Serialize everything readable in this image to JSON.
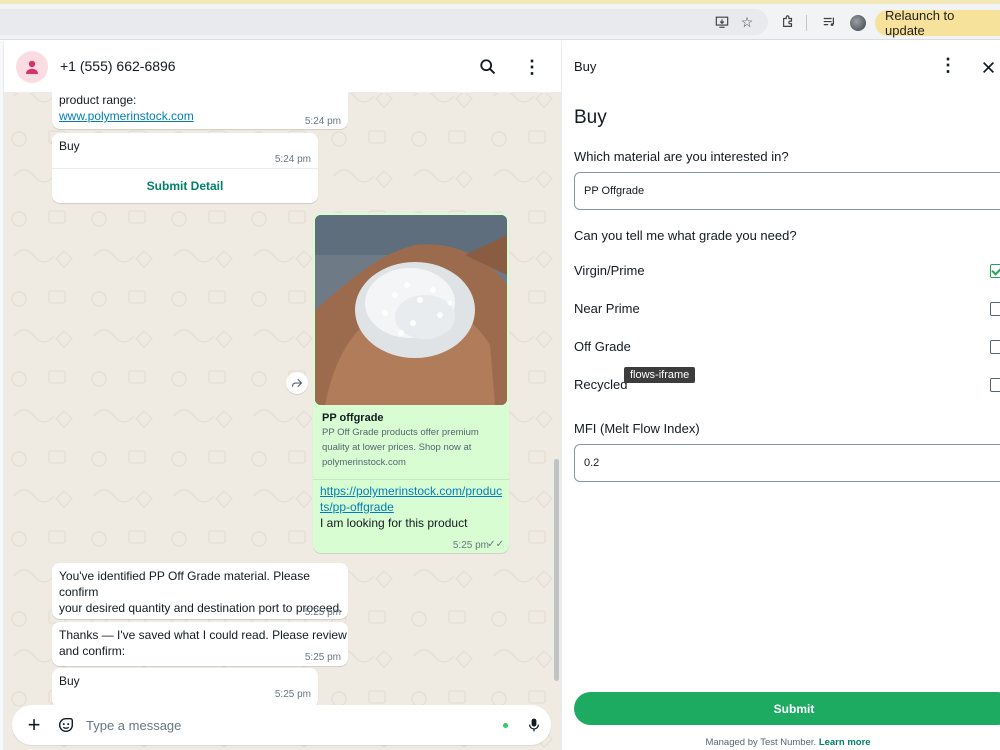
{
  "browser": {
    "relaunch_label": "Relaunch to update"
  },
  "chat": {
    "contact_name": "+1 (555) 662-6896",
    "messages": [
      {
        "text1": "product range:",
        "link": "www.polymerinstock.com",
        "time": "5:24 pm"
      },
      {
        "text": "Buy",
        "time": "5:24 pm",
        "button": "Submit Detail"
      },
      {
        "card_title": "PP offgrade",
        "card_desc1": "PP Off Grade products offer premium",
        "card_desc2": "quality at lower prices. Shop now at",
        "card_domain": "polymerinstock.com",
        "link1": "https://polymerinstock.com/produc",
        "link2": "ts/pp-offgrade",
        "text": "I am looking for this product",
        "time": "5:25 pm"
      },
      {
        "line1": "You've identified PP Off Grade material. Please confirm",
        "line2": "your desired quantity and destination port to proceed.",
        "time": "5:25 pm"
      },
      {
        "line1": "Thanks — I've saved what I could read. Please review",
        "line2": "and confirm:",
        "time": "5:25 pm"
      },
      {
        "text": "Buy",
        "time": "5:25 pm"
      }
    ],
    "composer_placeholder": "Type a message"
  },
  "panel": {
    "header_title": "Buy",
    "heading": "Buy",
    "q1_label": "Which material are you interested in?",
    "q1_value": "PP Offgrade",
    "q2_label": "Can you tell me what grade you need?",
    "options": [
      {
        "label": "Virgin/Prime",
        "checked": true
      },
      {
        "label": "Near Prime",
        "checked": false
      },
      {
        "label": "Off Grade",
        "checked": false
      },
      {
        "label": "Recycled",
        "checked": false
      }
    ],
    "tooltip": "flows-iframe",
    "mfi_label": "MFI (Melt Flow Index)",
    "mfi_value": "0.2",
    "submit_label": "Submit",
    "managed_text": "Managed by Test Number.",
    "learn_more": "Learn more"
  },
  "colors": {
    "accent": "#1daa61",
    "outgoing_bubble": "#d9fdd3",
    "chat_background": "#efeae2"
  }
}
